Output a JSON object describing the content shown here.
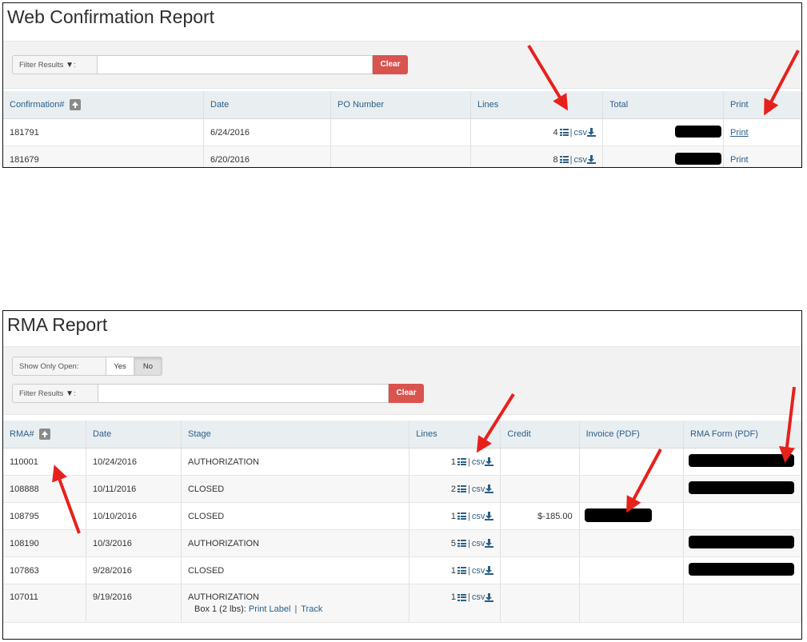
{
  "wcr": {
    "title": "Web Confirmation Report",
    "filter": {
      "label": "Filter Results",
      "colon": ":",
      "value": "",
      "clear_label": "Clear"
    },
    "columns": [
      "Confirmation#",
      "Date",
      "PO Number",
      "Lines",
      "Total",
      "Print"
    ],
    "rows": [
      {
        "confirmation": "181791",
        "date": "6/24/2016",
        "po": "",
        "lines": "4",
        "csv": "csv",
        "print": "Print"
      },
      {
        "confirmation": "181679",
        "date": "6/20/2016",
        "po": "",
        "lines": "8",
        "csv": "csv",
        "print": "Print"
      }
    ]
  },
  "rma": {
    "title": "RMA Report",
    "show_only_open": {
      "label": "Show Only Open:",
      "yes": "Yes",
      "no": "No",
      "selected": "No"
    },
    "filter": {
      "label": "Filter Results",
      "colon": ":",
      "value": "",
      "clear_label": "Clear"
    },
    "columns": [
      "RMA#",
      "Date",
      "Stage",
      "Lines",
      "Credit",
      "Invoice (PDF)",
      "RMA Form (PDF)"
    ],
    "rows": [
      {
        "rma": "110001",
        "date": "10/24/2016",
        "stage": "AUTHORIZATION",
        "lines": "1",
        "csv": "csv",
        "credit": ""
      },
      {
        "rma": "108888",
        "date": "10/11/2016",
        "stage": "CLOSED",
        "lines": "2",
        "csv": "csv",
        "credit": ""
      },
      {
        "rma": "108795",
        "date": "10/10/2016",
        "stage": "CLOSED",
        "lines": "1",
        "csv": "csv",
        "credit": "$-185.00"
      },
      {
        "rma": "108190",
        "date": "10/3/2016",
        "stage": "AUTHORIZATION",
        "lines": "5",
        "csv": "csv",
        "credit": ""
      },
      {
        "rma": "107863",
        "date": "9/28/2016",
        "stage": "CLOSED",
        "lines": "1",
        "csv": "csv",
        "credit": ""
      },
      {
        "rma": "107011",
        "date": "9/19/2016",
        "stage": "AUTHORIZATION",
        "lines": "1",
        "csv": "csv",
        "credit": "",
        "box": {
          "prefix": "Box 1 (2 lbs):",
          "print_label": "Print Label",
          "sep": "|",
          "track": "Track"
        }
      }
    ]
  },
  "icons": {
    "sort": "sort-ascending-icon",
    "filter": "filter-funnel-icon",
    "list": "list-icon",
    "download": "download-icon"
  },
  "colors": {
    "accent": "#2a5f88",
    "clear_button": "#d9534f",
    "arrow": "#e8201c",
    "header_bg": "#e9eef1"
  }
}
